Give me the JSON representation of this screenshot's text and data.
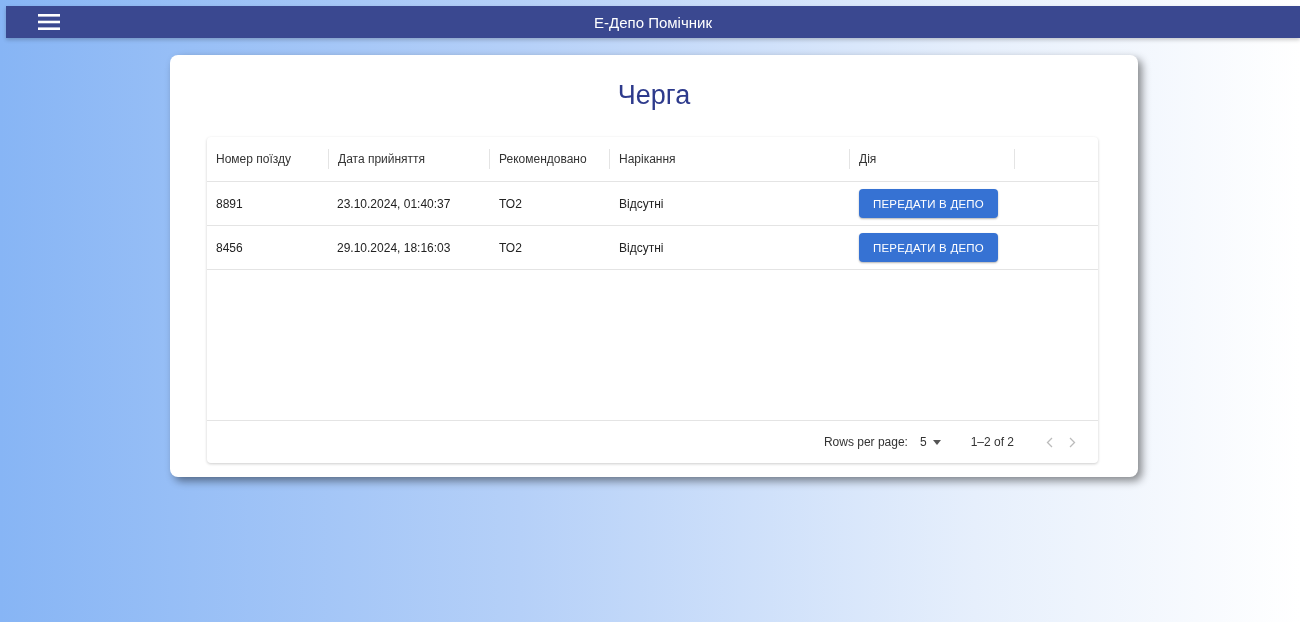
{
  "app_bar": {
    "title": "Е-Депо Помічник"
  },
  "page": {
    "title": "Черга"
  },
  "table": {
    "columns": [
      "Номер поїзду",
      "Дата прийняття",
      "Рекомендовано",
      "Нарікання",
      "Дія"
    ],
    "rows": [
      {
        "train": "8891",
        "date": "23.10.2024, 01:40:37",
        "recommended": "ТО2",
        "complaints": "Відсутні",
        "action": "ПЕРЕДАТИ В ДЕПО"
      },
      {
        "train": "8456",
        "date": "29.10.2024, 18:16:03",
        "recommended": "ТО2",
        "complaints": "Відсутні",
        "action": "ПЕРЕДАТИ В ДЕПО"
      }
    ]
  },
  "pagination": {
    "rows_per_page_label": "Rows per page:",
    "rows_per_page": "5",
    "range": "1–2 of 2",
    "previous": {
      "disabled": true
    },
    "next": {
      "disabled": true
    }
  }
}
